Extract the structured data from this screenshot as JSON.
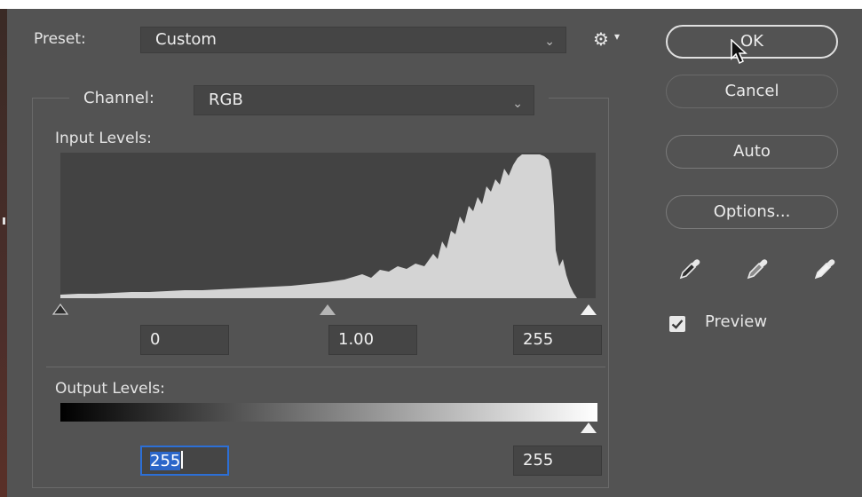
{
  "window": {
    "preset_label": "Preset:",
    "preset_value": "Custom",
    "channel_label": "Channel:",
    "channel_value": "RGB",
    "input_levels_label": "Input Levels:",
    "output_levels_label": "Output Levels:"
  },
  "input_levels": {
    "black": "0",
    "gamma": "1.00",
    "white": "255"
  },
  "output_levels": {
    "black": "255",
    "white": "255"
  },
  "buttons": {
    "ok": "OK",
    "cancel": "Cancel",
    "auto": "Auto",
    "options": "Options..."
  },
  "preview": {
    "label": "Preview",
    "checked": true
  },
  "icons": {
    "gear": "gear-icon",
    "dropdown": "chevron-down-icon",
    "droppers": [
      "black-point-eyedropper-icon",
      "gray-point-eyedropper-icon",
      "white-point-eyedropper-icon"
    ],
    "cursor": "mouse-pointer-icon"
  },
  "colors": {
    "dialog_bg": "#535353",
    "field_bg": "#454545",
    "histogram_bg": "#434343",
    "histogram_fill": "#d4d4d4",
    "focus_blue": "#2c6fd6"
  }
}
